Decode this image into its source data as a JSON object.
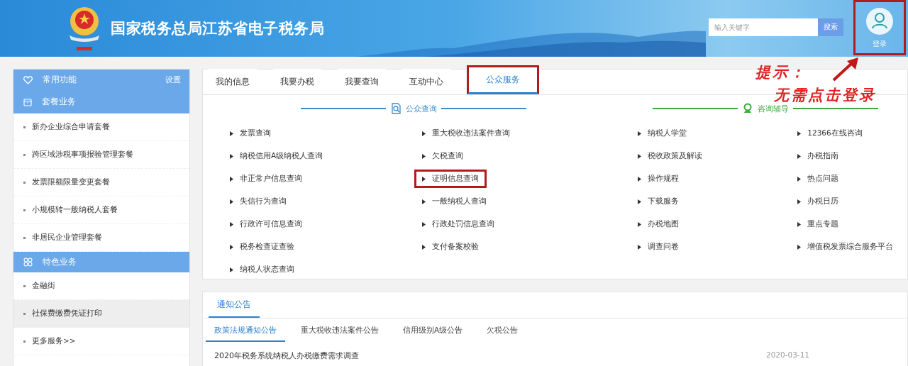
{
  "header": {
    "title": "国家税务总局江苏省电子税务局",
    "search": {
      "placeholder": "输入关键字",
      "button": "搜索"
    },
    "login": {
      "label": "登录",
      "annotated": true
    }
  },
  "sidebar": {
    "groups": [
      {
        "title": "常用功能",
        "kind": "favorites",
        "action": "设置"
      },
      {
        "title": "套餐业务",
        "kind": "package",
        "items": [
          {
            "label": "新办企业综合申请套餐",
            "hovered": false
          },
          {
            "label": "跨区域涉税事项报验管理套餐",
            "hovered": false
          },
          {
            "label": "发票限额限量变更套餐",
            "hovered": false
          },
          {
            "label": "小规模转一般纳税人套餐",
            "hovered": false
          },
          {
            "label": "非居民企业管理套餐",
            "hovered": false
          }
        ]
      },
      {
        "title": "特色业务",
        "kind": "featured",
        "items": [
          {
            "label": "金融街",
            "hovered": false
          },
          {
            "label": "社保费缴费凭证打印",
            "hovered": true
          },
          {
            "label": "更多服务>>",
            "hovered": false
          }
        ]
      }
    ]
  },
  "tabs": [
    {
      "label": "我的信息",
      "selected": false,
      "annotated": false
    },
    {
      "label": "我要办税",
      "selected": false,
      "annotated": false
    },
    {
      "label": "我要查询",
      "selected": false,
      "annotated": false
    },
    {
      "label": "互动中心",
      "selected": false,
      "annotated": false
    },
    {
      "label": "公众服务",
      "selected": true,
      "annotated": true
    }
  ],
  "sections": [
    {
      "title": "公众查询",
      "kind": "search",
      "color": "#3a8ed0",
      "columns": [
        [
          {
            "label": "发票查询",
            "annotated": false
          },
          {
            "label": "纳税信用A级纳税人查询",
            "annotated": false
          },
          {
            "label": "非正常户信息查询",
            "annotated": false
          },
          {
            "label": "失信行为查询",
            "annotated": false
          },
          {
            "label": "行政许可信息查询",
            "annotated": false
          },
          {
            "label": "税务检查证查验",
            "annotated": false
          },
          {
            "label": "纳税人状态查询",
            "annotated": false
          }
        ],
        [
          {
            "label": "重大税收违法案件查询",
            "annotated": false
          },
          {
            "label": "欠税查询",
            "annotated": false
          },
          {
            "label": "证明信息查询",
            "annotated": true
          },
          {
            "label": "一般纳税人查询",
            "annotated": false
          },
          {
            "label": "行政处罚信息查询",
            "annotated": false
          },
          {
            "label": "支付备案校验",
            "annotated": false
          }
        ]
      ]
    },
    {
      "title": "咨询辅导",
      "kind": "consult",
      "color": "#3aa83a",
      "columns": [
        [
          {
            "label": "纳税人学堂",
            "annotated": false
          },
          {
            "label": "税收政策及解读",
            "annotated": false
          },
          {
            "label": "操作规程",
            "annotated": false
          },
          {
            "label": "下载服务",
            "annotated": false
          },
          {
            "label": "办税地图",
            "annotated": false
          },
          {
            "label": "调查问卷",
            "annotated": false
          }
        ],
        [
          {
            "label": "12366在线咨询",
            "annotated": false
          },
          {
            "label": "办税指南",
            "annotated": false
          },
          {
            "label": "热点问题",
            "annotated": false
          },
          {
            "label": "办税日历",
            "annotated": false
          },
          {
            "label": "重点专题",
            "annotated": false
          },
          {
            "label": "增值税发票综合服务平台",
            "annotated": false
          }
        ]
      ]
    }
  ],
  "annotation": {
    "lines": [
      "提示：",
      "无需点击登录"
    ]
  },
  "notices": {
    "tab": "通知公告",
    "subtabs": [
      {
        "label": "政策法规通知公告",
        "selected": true
      },
      {
        "label": "重大税收违法案件公告",
        "selected": false
      },
      {
        "label": "信用级别A级公告",
        "selected": false
      },
      {
        "label": "欠税公告",
        "selected": false
      }
    ],
    "items": [
      {
        "title": "2020年税务系统纳税人办税缴费需求调查",
        "date": "2020-03-11"
      }
    ]
  }
}
